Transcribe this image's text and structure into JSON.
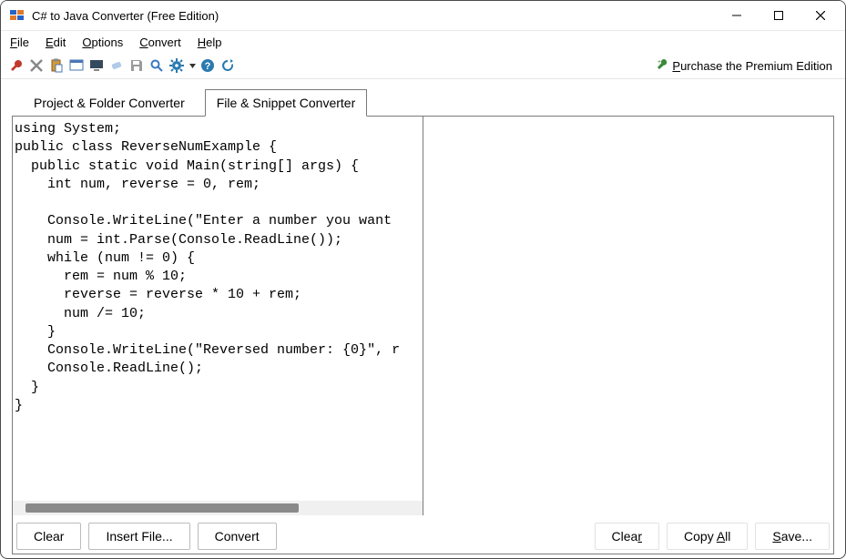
{
  "titlebar": {
    "title": "C# to Java Converter (Free Edition)"
  },
  "menubar": {
    "items": [
      {
        "pre": "",
        "mn": "F",
        "post": "ile"
      },
      {
        "pre": "",
        "mn": "E",
        "post": "dit"
      },
      {
        "pre": "",
        "mn": "O",
        "post": "ptions"
      },
      {
        "pre": "",
        "mn": "C",
        "post": "onvert"
      },
      {
        "pre": "",
        "mn": "H",
        "post": "elp"
      }
    ]
  },
  "toolbar": {
    "premium_pre": "",
    "premium_mn": "P",
    "premium_post": "urchase the Premium Edition"
  },
  "tabs": {
    "project": "Project & Folder Converter",
    "file": "File & Snippet Converter"
  },
  "code": {
    "left": "using System;\npublic class ReverseNumExample {\n  public static void Main(string[] args) {\n    int num, reverse = 0, rem;\n\n    Console.WriteLine(\"Enter a number you want \n    num = int.Parse(Console.ReadLine());\n    while (num != 0) {\n      rem = num % 10;\n      reverse = reverse * 10 + rem;\n      num /= 10;\n    }\n    Console.WriteLine(\"Reversed number: {0}\", r\n    Console.ReadLine();\n  }\n}",
    "right": ""
  },
  "buttons": {
    "clear_left": "Clear",
    "insert_file": "Insert File...",
    "convert": "Convert",
    "clear_right_pre": "Clea",
    "clear_right_mn": "r",
    "copy_all_pre": "Copy ",
    "copy_all_mn": "A",
    "copy_all_post": "ll",
    "save_pre": "",
    "save_mn": "S",
    "save_post": "ave..."
  }
}
